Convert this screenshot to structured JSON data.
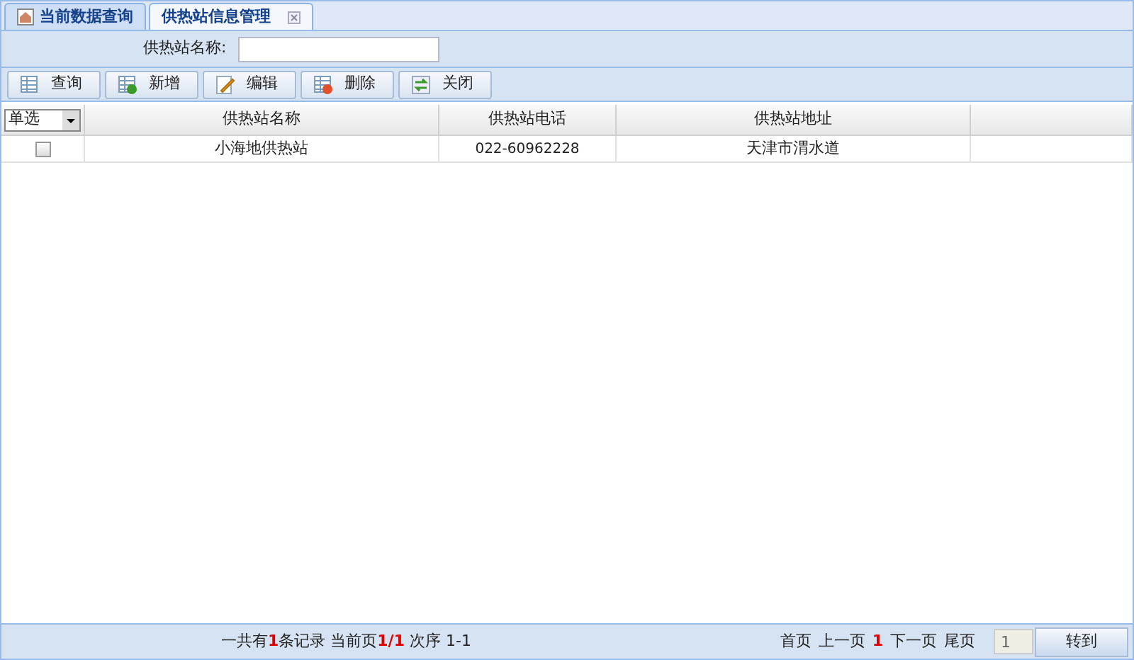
{
  "tabs": [
    {
      "label": "当前数据查询",
      "selected": false,
      "closable": false
    },
    {
      "label": "供热站信息管理",
      "selected": true,
      "closable": true
    }
  ],
  "search": {
    "label": "供热站名称:"
  },
  "toolbar": [
    {
      "label": "查询",
      "kind": "query"
    },
    {
      "label": "新增",
      "kind": "add"
    },
    {
      "label": "编辑",
      "kind": "edit"
    },
    {
      "label": "删除",
      "kind": "delete"
    },
    {
      "label": "关闭",
      "kind": "close"
    }
  ],
  "table": {
    "select_mode": "单选",
    "columns": [
      "供热站名称",
      "供热站电话",
      "供热站地址"
    ],
    "rows": [
      {
        "checked": false,
        "cells": [
          "小海地供热站",
          "022-60962228",
          "天津市渭水道"
        ]
      }
    ]
  },
  "status_bar": {
    "summary": "一共有**1**条记录 当前页**1/1** 次序 1-1",
    "pager": [
      "首页",
      "上一页",
      "1",
      "下一页",
      "尾页"
    ],
    "page_input": "1",
    "go_button": "转到"
  }
}
